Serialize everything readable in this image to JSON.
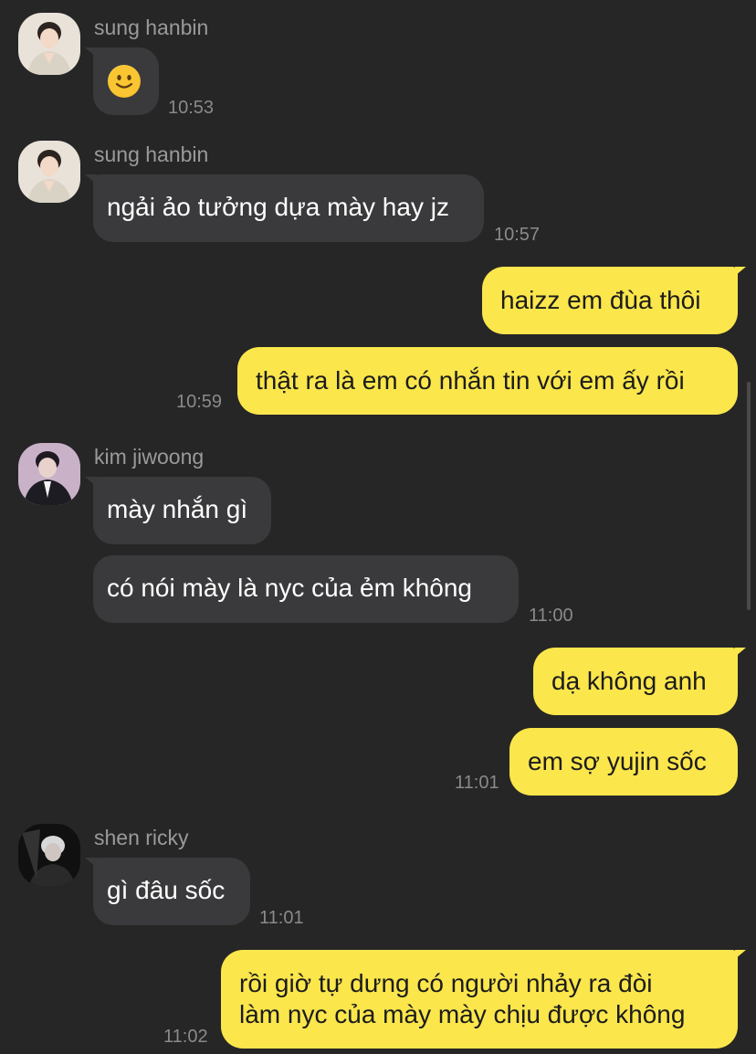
{
  "messages": [
    {
      "sender": "sung hanbin",
      "text": "🙂",
      "time": "10:53"
    },
    {
      "sender": "sung hanbin",
      "text": "ngải ảo tưởng dựa mày hay jz",
      "time": "10:57"
    },
    {
      "text": "haizz em đùa thôi"
    },
    {
      "text": "thật ra là em có nhắn tin với em ấy rồi",
      "time": "10:59"
    },
    {
      "sender": "kim jiwoong",
      "text": "mày nhắn gì"
    },
    {
      "text": "có nói mày là nyc của ẻm không",
      "time": "11:00"
    },
    {
      "text": "dạ không anh"
    },
    {
      "text": "em sợ yujin sốc",
      "time": "11:01"
    },
    {
      "sender": "shen ricky",
      "text": "gì đâu sốc",
      "time": "11:01"
    },
    {
      "lines": [
        "rồi giờ tự dưng có người nhảy ra đòi",
        "làm nyc của mày mày chịu được không"
      ],
      "time": "11:02"
    }
  ],
  "colors": {
    "background": "#262626",
    "incoming_bubble": "#3a3a3c",
    "outgoing_bubble": "#fbe64c"
  },
  "icons": {
    "avatar_1": "avatar-photo",
    "avatar_2": "avatar-photo",
    "avatar_3": "avatar-photo",
    "avatar_4": "avatar-photo",
    "emoji": "slightly-smiling-face"
  }
}
